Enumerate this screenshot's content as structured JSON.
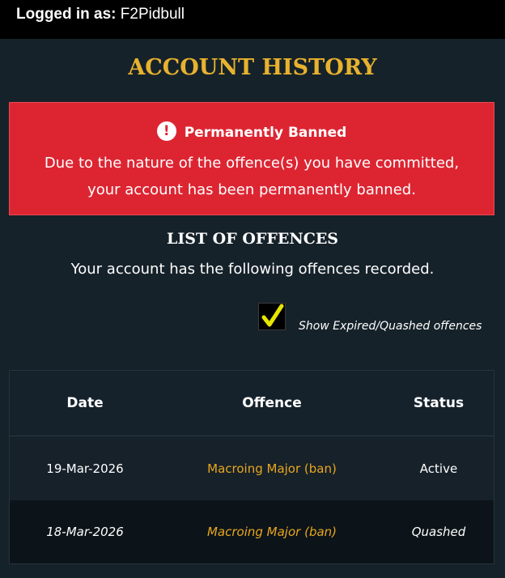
{
  "header": {
    "login_label": "Logged in as:",
    "username": "F2Pidbull"
  },
  "page": {
    "title": "ACCOUNT HISTORY"
  },
  "banner": {
    "icon": "alert-circle-icon",
    "heading": "Permanently Banned",
    "line1": "Due to the nature of the offence(s) you have committed,",
    "line2": "your account has been permanently banned.",
    "color": "#dd2532"
  },
  "offences": {
    "title": "LIST OF OFFENCES",
    "intro": "Your account has the following offences recorded.",
    "show_expired": {
      "label": "Show Expired/Quashed offences",
      "checked": true,
      "check_color": "#e6e600"
    },
    "columns": [
      "Date",
      "Offence",
      "Status"
    ],
    "rows": [
      {
        "date": "19-Mar-2026",
        "offence": "Macroing Major (ban)",
        "status": "Active"
      },
      {
        "date": "18-Mar-2026",
        "offence": "Macroing Major (ban)",
        "status": "Quashed"
      }
    ]
  },
  "colors": {
    "accent_gold": "#e8b22e",
    "offence_link": "#e8a61d",
    "background": "#16222a"
  }
}
